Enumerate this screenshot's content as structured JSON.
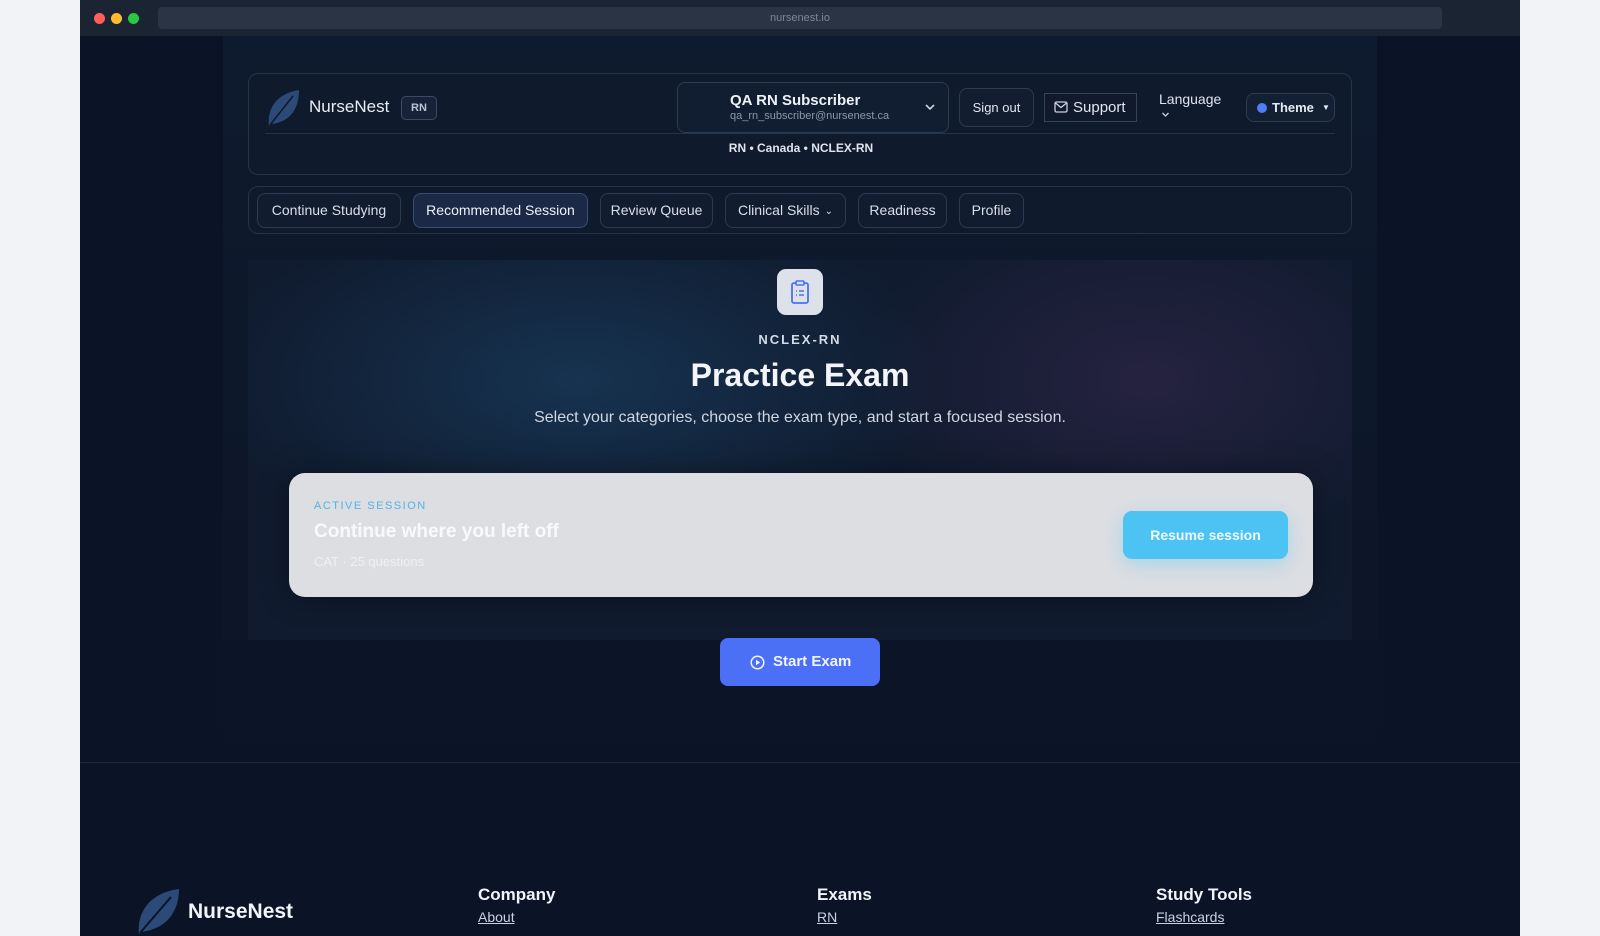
{
  "browser": {
    "url": "nursenest.io"
  },
  "header": {
    "brand": "NurseNest",
    "role_badge": "RN",
    "user": {
      "name": "QA RN Subscriber",
      "email": "qa_rn_subscriber@nursenest.ca"
    },
    "sign_out": "Sign out",
    "support": "Support",
    "language": "Language",
    "theme": "Theme",
    "meta": "RN • Canada • NCLEX-RN"
  },
  "nav": {
    "tabs": [
      {
        "label": "Continue Studying"
      },
      {
        "label": "Recommended Session",
        "active": true
      },
      {
        "label": "Review Queue"
      },
      {
        "label": "Clinical Skills",
        "has_dropdown": true
      },
      {
        "label": "Readiness"
      },
      {
        "label": "Profile"
      }
    ]
  },
  "hero": {
    "eyebrow": "NCLEX-RN",
    "title": "Practice Exam",
    "subtitle": "Select your categories, choose the exam type, and start a focused session."
  },
  "session": {
    "eyebrow": "ACTIVE SESSION",
    "title": "Continue where you left off",
    "meta": "CAT · 25 questions",
    "resume": "Resume session"
  },
  "start_exam": "Start Exam",
  "footer": {
    "brand": "NurseNest",
    "columns": [
      {
        "title": "Company",
        "links": [
          "About"
        ]
      },
      {
        "title": "Exams",
        "links": [
          "RN"
        ]
      },
      {
        "title": "Study Tools",
        "links": [
          "Flashcards"
        ]
      }
    ]
  },
  "colors": {
    "accent": "#4b70f5",
    "resume": "#4cc3f2",
    "background": "#0b1426"
  }
}
